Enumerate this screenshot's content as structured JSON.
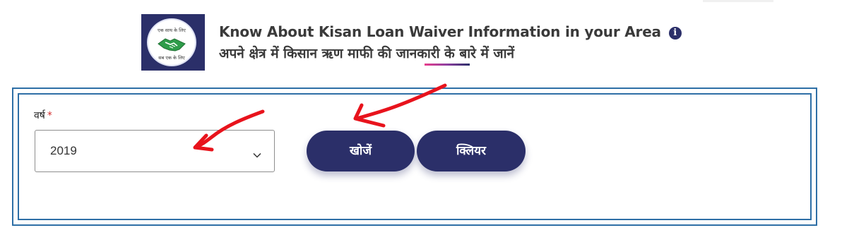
{
  "header": {
    "title": "Know About Kisan Loan Waiver Information in your Area",
    "info_glyph": "i",
    "subtitle": "अपने क्षेत्र में किसान ऋण माफी की जानकारी के बारे में जानें",
    "logo_top_text": "एक साथ के लिए",
    "logo_bottom_text": "सब एक के लिए"
  },
  "form": {
    "year_label": "वर्ष",
    "required_mark": "*",
    "year_value": "2019"
  },
  "buttons": {
    "search_label": "खोजें",
    "clear_label": "क्लियर"
  },
  "colors": {
    "primary": "#2b2f69",
    "panel_border": "#2e6fa6",
    "annotation_arrow": "#e8131c",
    "required": "#d32f2f"
  },
  "icons": {
    "info": "info-icon",
    "dropdown": "chevron-down-icon",
    "logo": "handshake-logo-icon"
  }
}
